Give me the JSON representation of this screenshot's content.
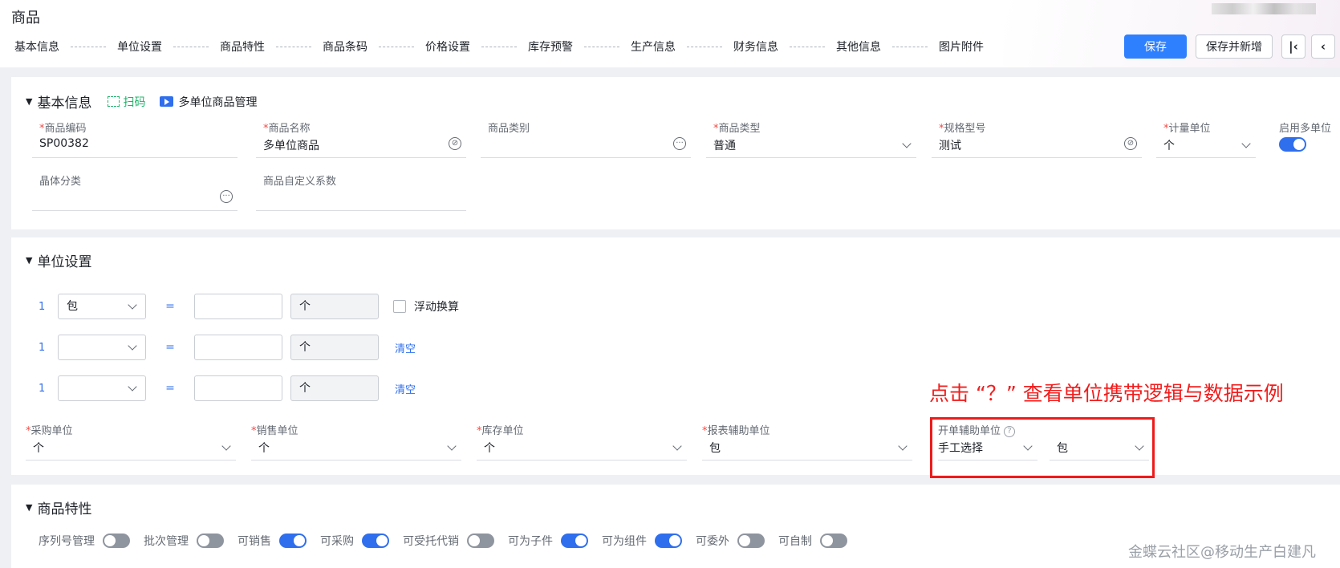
{
  "header": {
    "title": "商品",
    "nav_tabs": [
      "基本信息",
      "单位设置",
      "商品特性",
      "商品条码",
      "价格设置",
      "库存预警",
      "生产信息",
      "财务信息",
      "其他信息",
      "图片附件"
    ],
    "save_label": "保存",
    "save_new_label": "保存并新增",
    "first_icon": "⟨",
    "prev_icon": "‹"
  },
  "basic": {
    "title": "基本信息",
    "scan_label": "扫码",
    "multi_unit_label": "多单位商品管理",
    "fields": {
      "code": {
        "label": "商品编码",
        "value": "SP00382"
      },
      "name": {
        "label": "商品名称",
        "value": "多单位商品"
      },
      "category": {
        "label": "商品类别",
        "value": ""
      },
      "type": {
        "label": "商品类型",
        "value": "普通"
      },
      "spec": {
        "label": "规格型号",
        "value": "测试"
      },
      "unit": {
        "label": "计量单位",
        "value": "个"
      },
      "multi_unit": {
        "label": "启用多单位",
        "enabled": true
      },
      "crystal": {
        "label": "晶体分类",
        "value": ""
      },
      "custom_factor": {
        "label": "商品自定义系数",
        "value": ""
      }
    }
  },
  "units": {
    "title": "单位设置",
    "rows": [
      {
        "num": "1",
        "unit": "包",
        "eq": "=",
        "qty": "",
        "base": "个",
        "extra": "浮动换算"
      },
      {
        "num": "1",
        "unit": "",
        "eq": "=",
        "qty": "",
        "base": "个",
        "extra": "清空"
      },
      {
        "num": "1",
        "unit": "",
        "eq": "=",
        "qty": "",
        "base": "个",
        "extra": "清空"
      }
    ],
    "purchase": {
      "label": "采购单位",
      "value": "个"
    },
    "sales": {
      "label": "销售单位",
      "value": "个"
    },
    "stock": {
      "label": "库存单位",
      "value": "个"
    },
    "report": {
      "label": "报表辅助单位",
      "value": "包"
    },
    "billing": {
      "label": "开单辅助单位",
      "mode": "手工选择",
      "value": "包"
    }
  },
  "annotation": "点击 “？” 查看单位携带逻辑与数据示例",
  "features": {
    "title": "商品特性",
    "items": [
      {
        "label": "序列号管理",
        "on": false
      },
      {
        "label": "批次管理",
        "on": false
      },
      {
        "label": "可销售",
        "on": true
      },
      {
        "label": "可采购",
        "on": true
      },
      {
        "label": "可受托代销",
        "on": false
      },
      {
        "label": "可为子件",
        "on": true
      },
      {
        "label": "可为组件",
        "on": true
      },
      {
        "label": "可委外",
        "on": false
      },
      {
        "label": "可自制",
        "on": false
      }
    ]
  },
  "watermark": "金蝶云社区@移动生产白建凡",
  "colors": {
    "primary": "#2f80ff",
    "required": "#f54a45",
    "annotation": "#f21c1c",
    "link": "#2f6fed"
  }
}
